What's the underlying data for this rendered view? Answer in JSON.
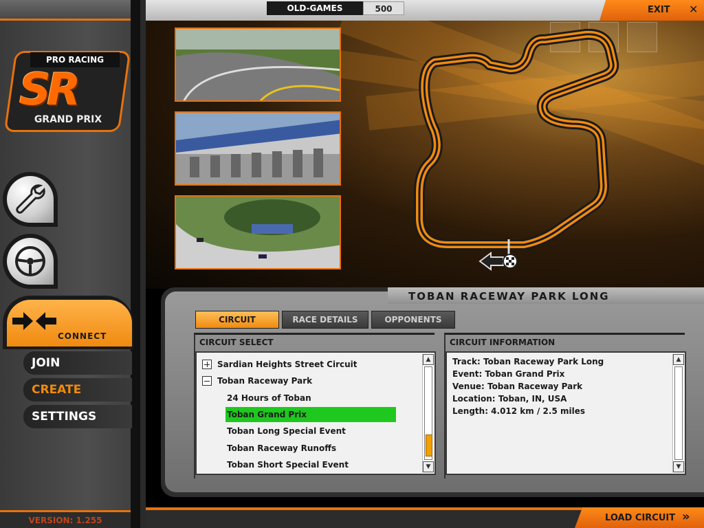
{
  "sidebar": {
    "logo": {
      "top_text": "PRO RACING",
      "big_text": "SR",
      "sub_text": "GRAND PRIX"
    },
    "buttons": [
      {
        "icon": "wrench-icon"
      },
      {
        "icon": "steering-wheel-icon"
      }
    ],
    "connect": {
      "label": "CONNECT",
      "icon": "arrows-converge-icon"
    },
    "menu": [
      {
        "label": "JOIN",
        "active": false
      },
      {
        "label": "CREATE",
        "active": true
      },
      {
        "label": "SETTINGS",
        "active": false
      }
    ],
    "version": "VERSION: 1.255"
  },
  "topbar": {
    "site": "OLD-GAMES",
    "count": "500",
    "exit_label": "EXIT",
    "exit_icon": "close-icon"
  },
  "track": {
    "name": "TOBAN RACEWAY PARK LONG",
    "direction_icon": "arrow-left-icon",
    "finish_icon": "checkered-flag-icon"
  },
  "tabs": [
    {
      "label": "CIRCUIT",
      "active": true
    },
    {
      "label": "RACE DETAILS",
      "active": false
    },
    {
      "label": "OPPONENTS",
      "active": false
    }
  ],
  "circuit_select": {
    "header": "CIRCUIT SELECT",
    "items": [
      {
        "label": "Sardian Heights Street Circuit",
        "level": 0,
        "expander": "plus",
        "selected": false
      },
      {
        "label": "Toban Raceway Park",
        "level": 0,
        "expander": "minus",
        "selected": false
      },
      {
        "label": "24 Hours of Toban",
        "level": 1,
        "selected": false
      },
      {
        "label": "Toban Grand Prix",
        "level": 1,
        "selected": true
      },
      {
        "label": "Toban Long Special Event",
        "level": 1,
        "selected": false
      },
      {
        "label": "Toban Raceway Runoffs",
        "level": 1,
        "selected": false
      },
      {
        "label": "Toban Short Special Event",
        "level": 1,
        "selected": false
      }
    ]
  },
  "circuit_info": {
    "header": "CIRCUIT INFORMATION",
    "lines": [
      "Track: Toban Raceway Park Long",
      "Event: Toban Grand Prix",
      "Venue: Toban Raceway Park",
      "Location: Toban, IN, USA",
      "Length: 4.012 km / 2.5 miles"
    ]
  },
  "footer": {
    "load_label": "LOAD CIRCUIT",
    "load_icon": "double-chevron-right-icon"
  },
  "colors": {
    "accent": "#e8720c",
    "selection": "#1ec81e",
    "panel": "#8a8a8a"
  }
}
